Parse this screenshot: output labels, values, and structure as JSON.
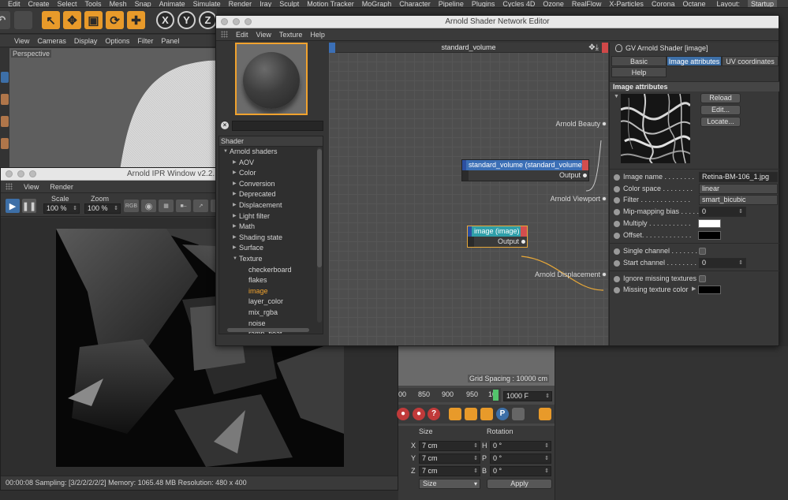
{
  "menubar": {
    "items": [
      "Edit",
      "Create",
      "Select",
      "Tools",
      "Mesh",
      "Snap",
      "Animate",
      "Simulate",
      "Render",
      "Iray",
      "Sculpt",
      "Motion Tracker",
      "MoGraph",
      "Character",
      "Pipeline",
      "Plugins",
      "Cycles 4D",
      "Ozone",
      "RealFlow",
      "X-Particles",
      "Corona",
      "Octane"
    ],
    "layout_label": "Layout:",
    "layout_value": "Startup"
  },
  "toolbar": {
    "axis_x": "X",
    "axis_y": "Y",
    "axis_z": "Z"
  },
  "viewport": {
    "menu": [
      "View",
      "Cameras",
      "Display",
      "Options",
      "Filter",
      "Panel"
    ],
    "label": "Perspective"
  },
  "ipr_window": {
    "title": "Arnold IPR Window v2.2.",
    "menu": [
      "View",
      "Render"
    ],
    "scale_label": "Scale",
    "scale_value": "100 %",
    "zoom_label": "Zoom",
    "zoom_value": "100 %",
    "rgb_label": "RGB",
    "status": "00:00:08  Sampling: [3/2/2/2/2/2]  Memory: 1065.48 MB  Resolution: 480 x 400"
  },
  "shader_editor": {
    "title": "Arnold Shader Network Editor",
    "menu": [
      "Edit",
      "View",
      "Texture",
      "Help"
    ],
    "tree": {
      "header": "Shader",
      "root": "Arnold shaders",
      "categories": [
        "AOV",
        "Color",
        "Conversion",
        "Deprecated",
        "Displacement",
        "Light filter",
        "Math",
        "Shading state",
        "Surface",
        "Texture"
      ],
      "texture_items": [
        "checkerboard",
        "flakes",
        "image",
        "layer_color",
        "mix_rgba",
        "noise",
        "ramp_float"
      ],
      "selected": "image"
    },
    "graph": {
      "title": "standard_volume",
      "ports": {
        "beauty": "Arnold Beauty",
        "viewport": "Arnold Viewport",
        "displacement": "Arnold Displacement"
      },
      "nodes": {
        "volume": {
          "title": "standard_volume (standard_volume)",
          "output": "Output"
        },
        "image": {
          "title": "image (image)",
          "output": "Output"
        }
      },
      "grid_spacing": "Grid Spacing : 10000 cm"
    },
    "attributes": {
      "header": "GV Arnold Shader [image]",
      "tabs": [
        "Basic",
        "Image attributes",
        "UV coordinates",
        "Help"
      ],
      "active_tab": "Image attributes",
      "section": "Image attributes",
      "buttons": [
        "Reload",
        "Edit...",
        "Locate..."
      ],
      "params": {
        "image_name": {
          "label": "Image name . . . . . . . .",
          "value": "Retina-BM-106_1.jpg"
        },
        "color_space": {
          "label": "Color space . . . . . . . .",
          "value": "linear"
        },
        "filter": {
          "label": "Filter . . . . . . . . . . . . .",
          "value": "smart_bicubic"
        },
        "mip_bias": {
          "label": "Mip-mapping bias . . . . .",
          "value": "0"
        },
        "multiply": {
          "label": "Multiply . . . . . . . . . . .",
          "color": "#ffffff"
        },
        "offset": {
          "label": "Offset. . . . . . . . . . . . .",
          "color": "#000000"
        },
        "single_channel": {
          "label": "Single channel . . . . . . ."
        },
        "start_channel": {
          "label": "Start channel . . . . . . . .",
          "value": "0"
        },
        "ignore_missing": {
          "label": "Ignore missing textures"
        },
        "missing_color": {
          "label": "Missing texture color",
          "color": "#000000"
        }
      }
    }
  },
  "timeline": {
    "ticks": [
      "00",
      "850",
      "900",
      "950",
      "10"
    ],
    "end_frame": "1000 F"
  },
  "coords": {
    "size_header": "Size",
    "rotation_header": "Rotation",
    "rows": [
      {
        "axis": "X",
        "size": "7 cm",
        "rot_axis": "H",
        "rot": "0 °"
      },
      {
        "axis": "Y",
        "size": "7 cm",
        "rot_axis": "P",
        "rot": "0 °"
      },
      {
        "axis": "Z",
        "size": "7 cm",
        "rot_axis": "B",
        "rot": "0 °"
      }
    ],
    "mode_dropdown": "Size",
    "apply": "Apply"
  }
}
